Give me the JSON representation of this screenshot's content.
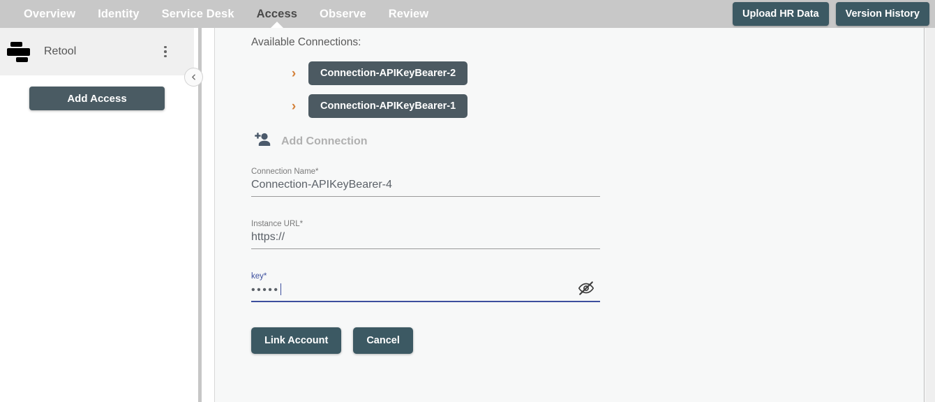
{
  "topbar": {
    "tabs": [
      {
        "label": "Overview",
        "active": false
      },
      {
        "label": "Identity",
        "active": false
      },
      {
        "label": "Service Desk",
        "active": false
      },
      {
        "label": "Access",
        "active": true
      },
      {
        "label": "Observe",
        "active": false
      },
      {
        "label": "Review",
        "active": false
      }
    ],
    "upload_button": "Upload HR Data",
    "version_button": "Version History",
    "background_color": "#c8c8c8",
    "button_color": "#3c5963"
  },
  "sidebar": {
    "app_name": "Retool",
    "app_logo_icon": "retool-logo-icon",
    "kebab_icon": "more-vertical-icon",
    "add_access_button": "Add Access",
    "collapse_icon": "chevron-left-icon"
  },
  "main": {
    "available_heading": "Available Connections:",
    "connections": [
      {
        "label": "Connection-APIKeyBearer-2",
        "expand_icon": "chevron-right-icon"
      },
      {
        "label": "Connection-APIKeyBearer-1",
        "expand_icon": "chevron-right-icon"
      }
    ],
    "add_connection": {
      "label": "Add Connection",
      "icon": "person-add-icon",
      "color": "#b0b0b0"
    },
    "chevron_color": "#d4813a",
    "form": {
      "fields": [
        {
          "label": "Connection Name*",
          "value": "Connection-APIKeyBearer-4",
          "focused": false
        },
        {
          "label": "Instance URL*",
          "value": "https://",
          "focused": false
        },
        {
          "label": "key*",
          "value": "•••••",
          "focused": true,
          "masked": true,
          "toggle_icon": "visibility-off-icon"
        }
      ],
      "focus_color": "#3c4f9e",
      "submit_button": "Link Account",
      "cancel_button": "Cancel"
    }
  }
}
